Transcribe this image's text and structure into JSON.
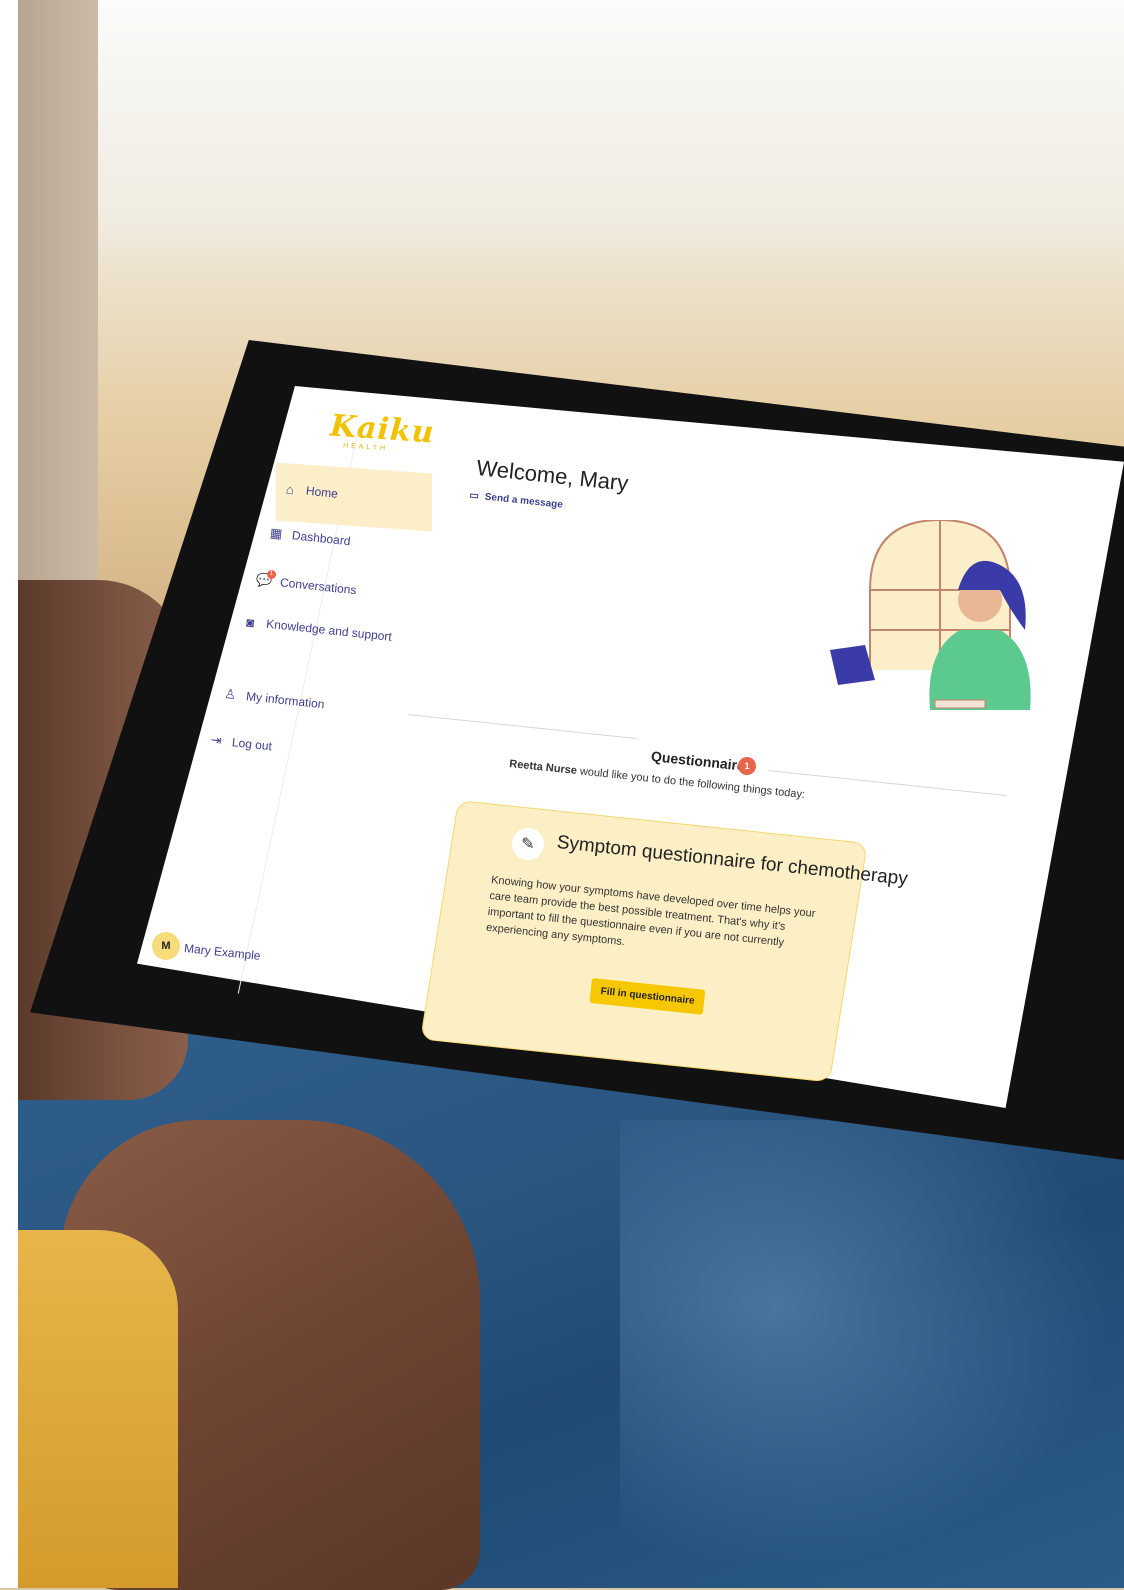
{
  "app": {
    "logo_text": "Kaiku",
    "logo_subtext": "HEALTH"
  },
  "sidebar": {
    "items": [
      {
        "label": "Home",
        "icon": "home-icon"
      },
      {
        "label": "Dashboard",
        "icon": "dashboard-icon"
      },
      {
        "label": "Conversations",
        "icon": "conversations-icon",
        "badge": "1"
      },
      {
        "label": "Knowledge and support",
        "icon": "knowledge-icon"
      },
      {
        "label": "My information",
        "icon": "user-icon"
      },
      {
        "label": "Log out",
        "icon": "logout-icon"
      }
    ],
    "user": {
      "initial": "M",
      "name": "Mary Example"
    }
  },
  "main": {
    "welcome": "Welcome, Mary",
    "send_message": "Send a message",
    "questionnaires": {
      "title": "Questionnaires",
      "count": "1",
      "nurse_name": "Reetta Nurse",
      "subtitle_rest": " would like you to do the following things today:"
    },
    "card": {
      "title": "Symptom questionnaire for chemotherapy",
      "body": "Knowing how your symptoms have developed over time helps your care team provide the best possible treatment. That's why it's important to fill the questionnaire even if you are not currently experiencing any symptoms.",
      "button": "Fill in questionnaire"
    }
  },
  "colors": {
    "accent_yellow": "#f7c800",
    "nav_active_bg": "#fbeec8",
    "card_bg": "#fcefc5",
    "badge_red": "#e8644b",
    "nav_text": "#3f3f8f"
  }
}
